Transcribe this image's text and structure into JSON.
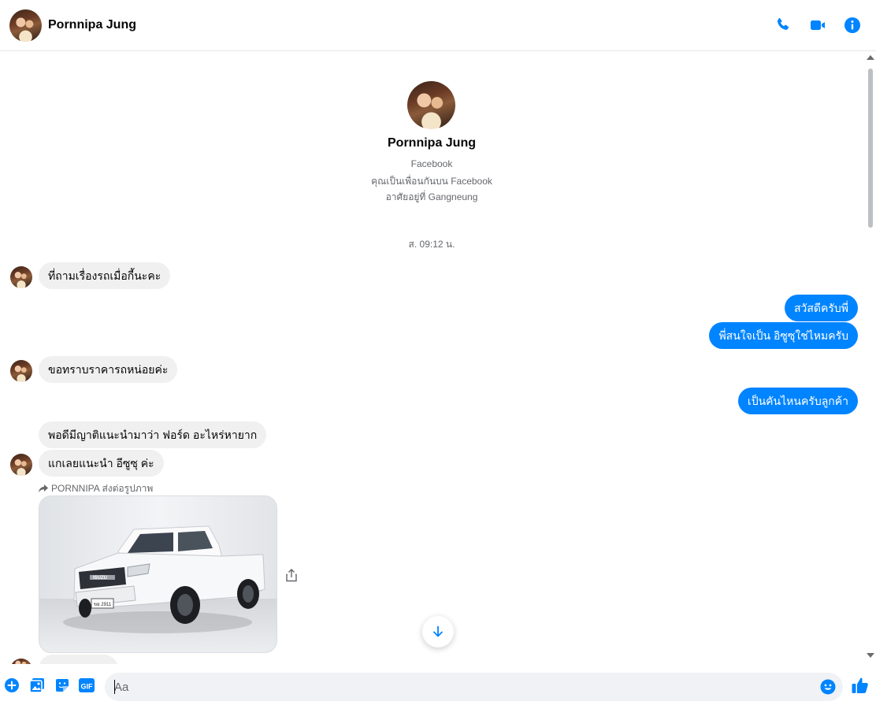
{
  "header": {
    "contact_name": "Pornnipa Jung",
    "icons": [
      "phone-icon",
      "video-camera-icon",
      "info-icon"
    ]
  },
  "profile": {
    "name": "Pornnipa Jung",
    "line1": "Facebook",
    "line2": "คุณเป็นเพื่อนกันบน Facebook",
    "line3": "อาศัยอยู่ที่ Gangneung"
  },
  "timestamp": "ส. 09:12 น.",
  "messages": [
    {
      "from": "them",
      "text": "ที่ถามเรื่องรถเมื่อกี้นะคะ"
    },
    {
      "from": "me",
      "text": "สวัสดีครับพี่"
    },
    {
      "from": "me",
      "text": "พี่สนใจเป็น อิซูซุใช่ไหมครับ"
    },
    {
      "from": "them",
      "text": "ขอทราบราคารถหน่อยค่ะ"
    },
    {
      "from": "me",
      "text": "เป็นคันไหนครับลูกค้า"
    },
    {
      "from": "them",
      "text": "พอดีมีญาติแนะนำมาว่า ฟอร์ด อะไหร่หายาก"
    },
    {
      "from": "them",
      "text": "แกเลยแนะนำ อีซูซุ ค่ะ"
    }
  ],
  "forwarded": {
    "label": "PORNNIPA ส่งต่อรูปภาพ",
    "image_description_plate": "ขย 2911",
    "brand_badge": "ISUZU"
  },
  "composer": {
    "placeholder": "Aa",
    "value": "",
    "gif_label": "GIF"
  },
  "colors": {
    "accent": "#0084ff",
    "incoming_bubble": "#f0f0f0",
    "secondary_text": "#65676b"
  }
}
